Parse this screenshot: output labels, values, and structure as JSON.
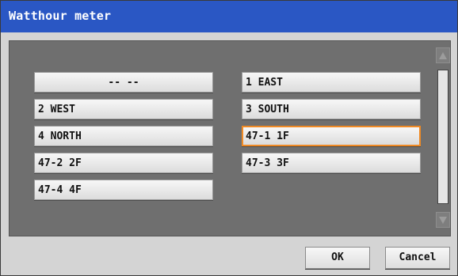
{
  "title": "Watthour meter",
  "items": [
    "-- --",
    "1 EAST",
    "2 WEST",
    "3 SOUTH",
    "4 NORTH",
    "47-1 1F",
    "47-2 2F",
    "47-3 3F",
    "47-4 4F"
  ],
  "selected_item": "47-1 1F",
  "buttons": {
    "ok": "OK",
    "cancel": "Cancel"
  },
  "colors": {
    "titlebar": "#2a57c4",
    "selection": "#f08a24",
    "panel": "#6f6f6f"
  }
}
